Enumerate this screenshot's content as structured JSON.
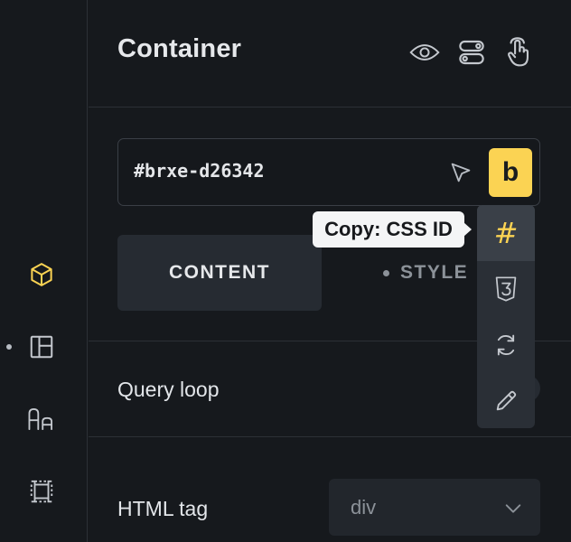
{
  "rail": {
    "icons": [
      "cube-icon",
      "layout-icon",
      "typography-icon",
      "frame-icon"
    ],
    "active_color": "#fbd353"
  },
  "header": {
    "title": "Container",
    "icons": [
      "eye-icon",
      "toggle-icon",
      "hand-pointer-icon"
    ]
  },
  "id_field": {
    "value": "#brxe-d26342",
    "cursor_icon": "cursor-arrow-icon",
    "brand_button_label": "b",
    "brand_color": "#fbd353"
  },
  "tooltip": {
    "text": "Copy: CSS ID"
  },
  "popover": {
    "items": [
      "hash-icon",
      "css3-icon",
      "refresh-icon",
      "pencil-icon"
    ],
    "hash_label": "#"
  },
  "tabs": {
    "content_label": "CONTENT",
    "style_label": "STYLE"
  },
  "controls": {
    "query_loop_label": "Query loop",
    "html_tag_label": "HTML tag",
    "html_tag_value": "div"
  }
}
